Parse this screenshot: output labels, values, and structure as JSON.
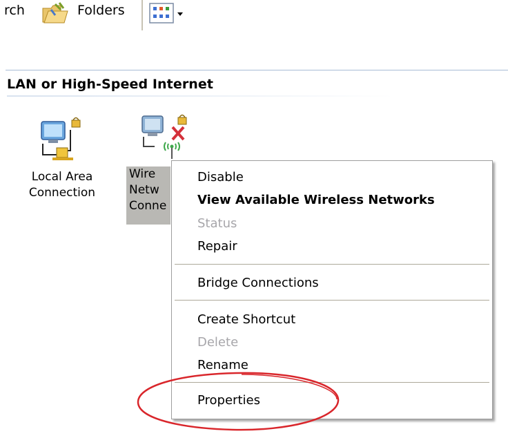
{
  "toolbar": {
    "search_label": "rch",
    "folders_label": "Folders",
    "folders_icon": "folder-icon",
    "views_icon": "views-icon",
    "views_arrow_icon": "chevron-down-icon"
  },
  "group": {
    "title": "LAN or High-Speed Internet"
  },
  "connections": [
    {
      "name": "Local Area Connection",
      "line1": "Local Area",
      "line2": "Connection",
      "icon": "network-connection-icon"
    },
    {
      "line1": "Wire",
      "line2": "Netw",
      "line3": "Conne",
      "icon": "wireless-connection-icon",
      "status": "disconnected",
      "selected": true
    }
  ],
  "context_menu": {
    "items": [
      {
        "label": "Disable",
        "enabled": true,
        "default": false
      },
      {
        "label": "View Available Wireless Networks",
        "enabled": true,
        "default": true
      },
      {
        "label": "Status",
        "enabled": false,
        "default": false
      },
      {
        "label": "Repair",
        "enabled": true,
        "default": false
      },
      {
        "label": "Bridge Connections",
        "enabled": true,
        "default": false
      },
      {
        "label": "Create Shortcut",
        "enabled": true,
        "default": false
      },
      {
        "label": "Delete",
        "enabled": false,
        "default": false
      },
      {
        "label": "Rename",
        "enabled": true,
        "default": false
      },
      {
        "label": "Properties",
        "enabled": true,
        "default": false
      }
    ]
  },
  "annotation": {
    "color": "#d9262b",
    "target": "Properties"
  },
  "colors": {
    "selection": "#b9b8b4",
    "disabled_text": "#a7a6aa",
    "separator": "#aca899"
  }
}
